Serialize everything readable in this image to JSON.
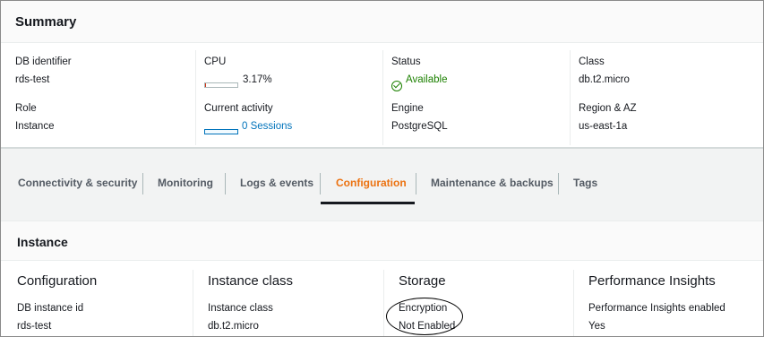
{
  "summary": {
    "title": "Summary",
    "db_identifier": {
      "label": "DB identifier",
      "value": "rds-test"
    },
    "cpu": {
      "label": "CPU",
      "value": "3.17%",
      "fraction": 0.0317
    },
    "status": {
      "label": "Status",
      "value": "Available",
      "icon": "check-circle-icon",
      "color": "#1d8102"
    },
    "class": {
      "label": "Class",
      "value": "db.t2.micro"
    },
    "role": {
      "label": "Role",
      "value": "Instance"
    },
    "current_activity": {
      "label": "Current activity",
      "value": "0 Sessions",
      "fraction": 0
    },
    "engine": {
      "label": "Engine",
      "value": "PostgreSQL"
    },
    "region": {
      "label": "Region & AZ",
      "value": "us-east-1a"
    }
  },
  "tabs": [
    {
      "label": "Connectivity & security",
      "active": false
    },
    {
      "label": "Monitoring",
      "active": false
    },
    {
      "label": "Logs & events",
      "active": false
    },
    {
      "label": "Configuration",
      "active": true
    },
    {
      "label": "Maintenance & backups",
      "active": false
    },
    {
      "label": "Tags",
      "active": false
    }
  ],
  "instance": {
    "title": "Instance",
    "columns": [
      {
        "heading": "Configuration",
        "label": "DB instance id",
        "value": "rds-test"
      },
      {
        "heading": "Instance class",
        "label": "Instance class",
        "value": "db.t2.micro"
      },
      {
        "heading": "Storage",
        "label": "Encryption",
        "value": "Not Enabled"
      },
      {
        "heading": "Performance Insights",
        "label": "Performance Insights enabled",
        "value": "Yes"
      }
    ]
  },
  "colors": {
    "accent": "#ec7211",
    "link": "#0073bb",
    "success": "#1d8102"
  }
}
